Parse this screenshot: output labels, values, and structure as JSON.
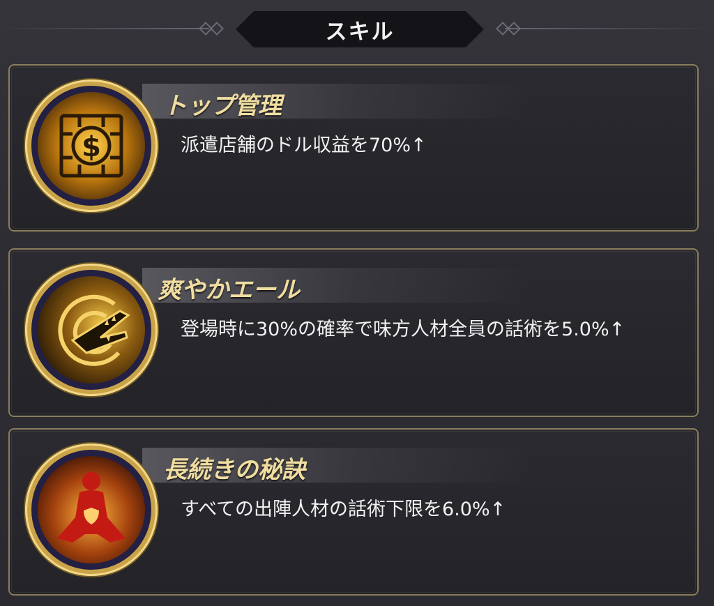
{
  "header": {
    "title": "スキル"
  },
  "skills": [
    {
      "name": "トップ管理",
      "description": "派遣店舗のドル収益を70%↑",
      "icon": "dollar-vault-icon"
    },
    {
      "name": "爽やかエール",
      "description": "登場時に30%の確率で味方人材全員の話術を5.0%↑",
      "icon": "crocodile-icon"
    },
    {
      "name": "長続きの秘訣",
      "description": "すべての出陣人材の話術下限を6.0%↑",
      "icon": "meditating-figure-shield-icon"
    }
  ],
  "colors": {
    "gold": "#c9a348",
    "name_text": "#f0dda0",
    "card_border": "#8a7d5c",
    "background": "#2b2b30"
  }
}
